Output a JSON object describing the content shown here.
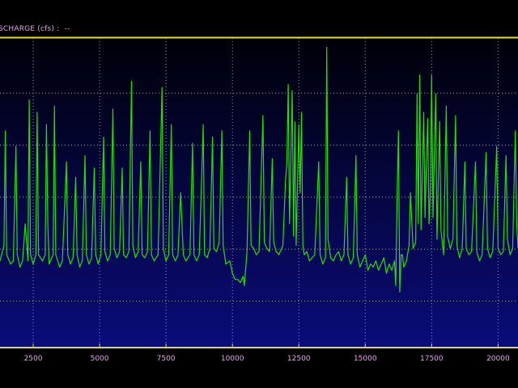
{
  "header": {
    "series_label": "SCHARGE (cfs) :",
    "value": "--"
  },
  "colors": {
    "background": "#000000",
    "plot_top": "#000008",
    "plot_bottom": "#0a0c7a",
    "frame": "#e8e000",
    "grid": "#9a9a9a",
    "series": "#22e000",
    "labels": "#e8a4f0"
  },
  "chart_data": {
    "type": "line",
    "title": "",
    "xlabel": "",
    "ylabel": "",
    "x_ticks": [
      "2500",
      "5000",
      "7500",
      "10000",
      "12500",
      "15000",
      "17500",
      "20000"
    ],
    "xlim": [
      1250,
      20750
    ],
    "ylim": [
      0,
      100
    ],
    "grid": true,
    "series": [
      {
        "values": [
          [
            1250,
            28
          ],
          [
            1400,
            33
          ],
          [
            1450,
            70
          ],
          [
            1500,
            30
          ],
          [
            1650,
            27
          ],
          [
            1750,
            28
          ],
          [
            1850,
            65
          ],
          [
            1900,
            30
          ],
          [
            2000,
            26
          ],
          [
            2100,
            28
          ],
          [
            2200,
            40
          ],
          [
            2300,
            28
          ],
          [
            2350,
            80
          ],
          [
            2400,
            30
          ],
          [
            2500,
            27
          ],
          [
            2600,
            30
          ],
          [
            2650,
            76
          ],
          [
            2700,
            30
          ],
          [
            2850,
            28
          ],
          [
            2950,
            30
          ],
          [
            3000,
            72
          ],
          [
            3050,
            40
          ],
          [
            3100,
            27
          ],
          [
            3250,
            30
          ],
          [
            3300,
            78
          ],
          [
            3350,
            30
          ],
          [
            3500,
            26
          ],
          [
            3600,
            28
          ],
          [
            3750,
            60
          ],
          [
            3800,
            30
          ],
          [
            3900,
            27
          ],
          [
            4000,
            29
          ],
          [
            4100,
            55
          ],
          [
            4150,
            30
          ],
          [
            4250,
            26
          ],
          [
            4350,
            28
          ],
          [
            4450,
            62
          ],
          [
            4500,
            30
          ],
          [
            4600,
            27
          ],
          [
            4700,
            29
          ],
          [
            4800,
            58
          ],
          [
            4850,
            30
          ],
          [
            4950,
            27
          ],
          [
            5050,
            30
          ],
          [
            5150,
            68
          ],
          [
            5200,
            31
          ],
          [
            5300,
            28
          ],
          [
            5400,
            30
          ],
          [
            5500,
            77
          ],
          [
            5550,
            32
          ],
          [
            5650,
            29
          ],
          [
            5750,
            31
          ],
          [
            5850,
            58
          ],
          [
            5900,
            30
          ],
          [
            6000,
            29
          ],
          [
            6100,
            31
          ],
          [
            6200,
            86
          ],
          [
            6250,
            33
          ],
          [
            6350,
            29
          ],
          [
            6450,
            31
          ],
          [
            6550,
            60
          ],
          [
            6600,
            30
          ],
          [
            6700,
            29
          ],
          [
            6800,
            31
          ],
          [
            6900,
            70
          ],
          [
            6950,
            30
          ],
          [
            7050,
            28
          ],
          [
            7200,
            30
          ],
          [
            7350,
            84
          ],
          [
            7400,
            32
          ],
          [
            7500,
            28
          ],
          [
            7600,
            30
          ],
          [
            7700,
            72
          ],
          [
            7750,
            30
          ],
          [
            7850,
            28
          ],
          [
            7950,
            30
          ],
          [
            8050,
            50
          ],
          [
            8150,
            30
          ],
          [
            8250,
            28
          ],
          [
            8400,
            30
          ],
          [
            8500,
            66
          ],
          [
            8550,
            30
          ],
          [
            8650,
            28
          ],
          [
            8750,
            30
          ],
          [
            8900,
            72
          ],
          [
            8950,
            30
          ],
          [
            9050,
            29
          ],
          [
            9150,
            32
          ],
          [
            9250,
            68
          ],
          [
            9300,
            32
          ],
          [
            9400,
            31
          ],
          [
            9500,
            34
          ],
          [
            9600,
            70
          ],
          [
            9650,
            33
          ],
          [
            9750,
            27
          ],
          [
            9900,
            28
          ],
          [
            10000,
            24
          ],
          [
            10100,
            22
          ],
          [
            10200,
            22
          ],
          [
            10300,
            21
          ],
          [
            10400,
            23
          ],
          [
            10450,
            20
          ],
          [
            10550,
            31
          ],
          [
            10650,
            70
          ],
          [
            10700,
            33
          ],
          [
            10800,
            32
          ],
          [
            10900,
            30
          ],
          [
            11000,
            31
          ],
          [
            11150,
            75
          ],
          [
            11200,
            34
          ],
          [
            11300,
            32
          ],
          [
            11400,
            31
          ],
          [
            11500,
            61
          ],
          [
            11550,
            34
          ],
          [
            11650,
            31
          ],
          [
            11750,
            30
          ],
          [
            11900,
            33
          ],
          [
            12000,
            54
          ],
          [
            12050,
            60
          ],
          [
            12100,
            85
          ],
          [
            12150,
            40
          ],
          [
            12250,
            83
          ],
          [
            12300,
            36
          ],
          [
            12350,
            73
          ],
          [
            12400,
            33
          ],
          [
            12500,
            72
          ],
          [
            12550,
            50
          ],
          [
            12600,
            76
          ],
          [
            12650,
            33
          ],
          [
            12700,
            30
          ],
          [
            12800,
            31
          ],
          [
            12900,
            28
          ],
          [
            13000,
            29
          ],
          [
            13100,
            30
          ],
          [
            13250,
            60
          ],
          [
            13300,
            30
          ],
          [
            13400,
            27
          ],
          [
            13500,
            29
          ],
          [
            13550,
            97
          ],
          [
            13600,
            35
          ],
          [
            13700,
            29
          ],
          [
            13800,
            28
          ],
          [
            13900,
            30
          ],
          [
            14000,
            31
          ],
          [
            14100,
            28
          ],
          [
            14200,
            30
          ],
          [
            14300,
            55
          ],
          [
            14350,
            30
          ],
          [
            14450,
            27
          ],
          [
            14550,
            29
          ],
          [
            14650,
            62
          ],
          [
            14700,
            30
          ],
          [
            14800,
            26
          ],
          [
            14900,
            28
          ],
          [
            15000,
            30
          ],
          [
            15100,
            25
          ],
          [
            15200,
            27
          ],
          [
            15300,
            26
          ],
          [
            15400,
            28
          ],
          [
            15500,
            25
          ],
          [
            15600,
            27
          ],
          [
            15700,
            29
          ],
          [
            15800,
            24
          ],
          [
            15900,
            27
          ],
          [
            16000,
            25
          ],
          [
            16100,
            28
          ],
          [
            16150,
            20
          ],
          [
            16200,
            50
          ],
          [
            16250,
            70
          ],
          [
            16300,
            18
          ],
          [
            16350,
            30
          ],
          [
            16400,
            30
          ],
          [
            16450,
            26
          ],
          [
            16550,
            28
          ],
          [
            16650,
            33
          ],
          [
            16700,
            50
          ],
          [
            16800,
            32
          ],
          [
            16900,
            34
          ],
          [
            16950,
            82
          ],
          [
            17000,
            40
          ],
          [
            17050,
            88
          ],
          [
            17100,
            38
          ],
          [
            17200,
            76
          ],
          [
            17250,
            42
          ],
          [
            17350,
            74
          ],
          [
            17400,
            40
          ],
          [
            17450,
            50
          ],
          [
            17500,
            88
          ],
          [
            17550,
            42
          ],
          [
            17650,
            82
          ],
          [
            17700,
            35
          ],
          [
            17800,
            73
          ],
          [
            17850,
            38
          ],
          [
            17950,
            30
          ],
          [
            18050,
            78
          ],
          [
            18100,
            36
          ],
          [
            18200,
            32
          ],
          [
            18300,
            35
          ],
          [
            18400,
            75
          ],
          [
            18450,
            33
          ],
          [
            18550,
            29
          ],
          [
            18650,
            32
          ],
          [
            18750,
            60
          ],
          [
            18800,
            32
          ],
          [
            18900,
            30
          ],
          [
            19000,
            31
          ],
          [
            19150,
            60
          ],
          [
            19200,
            31
          ],
          [
            19300,
            28
          ],
          [
            19400,
            30
          ],
          [
            19550,
            63
          ],
          [
            19600,
            32
          ],
          [
            19700,
            29
          ],
          [
            19800,
            31
          ],
          [
            19950,
            65
          ],
          [
            20000,
            32
          ],
          [
            20100,
            30
          ],
          [
            20200,
            31
          ],
          [
            20300,
            62
          ],
          [
            20350,
            35
          ],
          [
            20450,
            30
          ],
          [
            20550,
            32
          ],
          [
            20650,
            70
          ],
          [
            20700,
            40
          ],
          [
            20750,
            32
          ]
        ]
      }
    ]
  }
}
